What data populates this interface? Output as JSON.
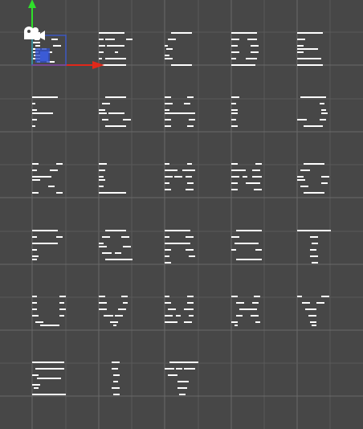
{
  "window": {
    "title": ""
  },
  "scene": {
    "background": "#474747",
    "grid_minor_color": "#5a5a5a",
    "grid_major_color": "#6a6a6a",
    "gizmo": {
      "x_axis_color": "#e0281a",
      "y_axis_color": "#2fe02a",
      "selection_color": "#3b5bd6",
      "camera_icon": "camera-icon"
    },
    "glyph_color": "#ffffff",
    "glyph_rows": 6,
    "glyph_columns": 5,
    "glyph_count": 28
  }
}
